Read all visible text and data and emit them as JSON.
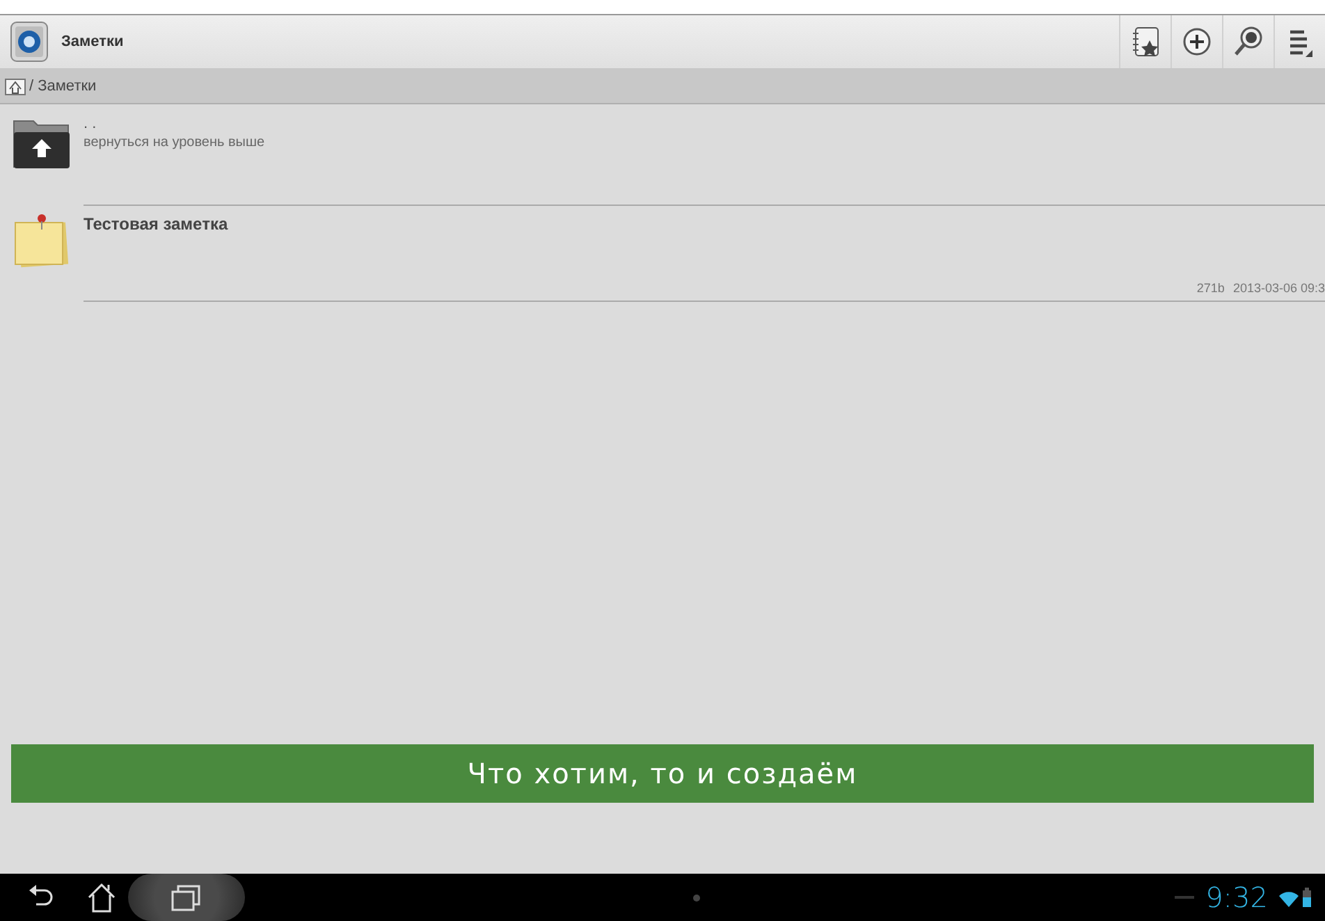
{
  "action_bar": {
    "title": "Заметки",
    "actions": [
      {
        "kind": "bookmarks"
      },
      {
        "kind": "add"
      },
      {
        "kind": "search"
      },
      {
        "kind": "menu"
      }
    ]
  },
  "breadcrumb": {
    "path": "/ Заметки"
  },
  "items": [
    {
      "kind": "up",
      "name": ". .",
      "subtitle": "вернуться на уровень выше"
    },
    {
      "kind": "note",
      "name": "Тестовая заметка",
      "size": "271b",
      "date": "2013-03-06 09:3"
    }
  ],
  "caption": "Что хотим, то и создаём",
  "nav_bar": {
    "recent_pressed": true,
    "time": "9:32"
  }
}
